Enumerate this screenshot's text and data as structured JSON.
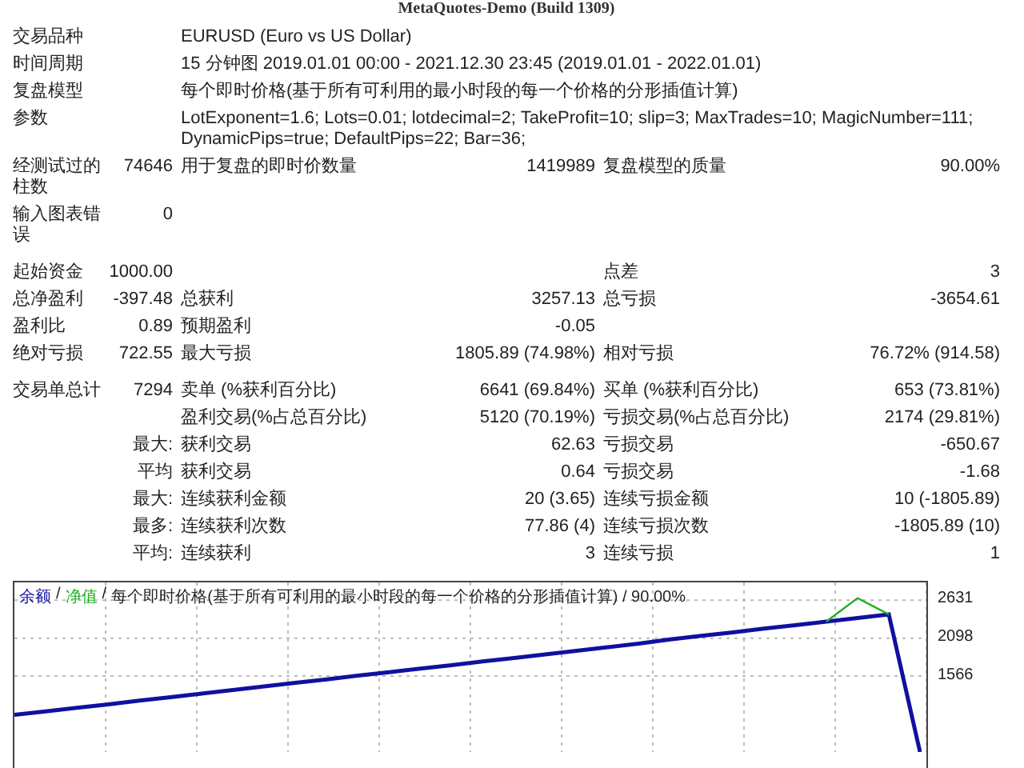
{
  "window": {
    "title": "MetaQuotes-Demo (Build 1309)"
  },
  "settings": [
    {
      "label": "交易品种",
      "text": "EURUSD (Euro vs US Dollar)"
    },
    {
      "label": "时间周期",
      "text": "15 分钟图 2019.01.01 00:00 - 2021.12.30 23:45 (2019.01.01 - 2022.01.01)"
    },
    {
      "label": "复盘模型",
      "text": "每个即时价格(基于所有可利用的最小时段的每一个价格的分形插值计算)"
    },
    {
      "label": "参数",
      "text": "LotExponent=1.6; Lots=0.01; lotdecimal=2; TakeProfit=10; slip=3; MaxTrades=10; MagicNumber=111; DynamicPips=true; DefaultPips=22; Bar=36;"
    }
  ],
  "test_info": [
    {
      "label": "经测试过的柱数",
      "value": "74646",
      "label_2": "用于复盘的即时价数量",
      "value_2": "1419989",
      "label_3": "复盘模型的质量",
      "value_3": "90.00%"
    },
    {
      "label": "输入图表错误",
      "value": "0"
    }
  ],
  "results": [
    {
      "label": "起始资金",
      "value": "1000.00",
      "label_3": "点差",
      "value_3": "3"
    },
    {
      "label": "总净盈利",
      "value": "-397.48",
      "label_2": "总获利",
      "value_2": "3257.13",
      "label_3": "总亏损",
      "value_3": "-3654.61"
    },
    {
      "label": "盈利比",
      "value": "0.89",
      "label_2": "预期盈利",
      "value_2": "-0.05"
    },
    {
      "label": "绝对亏损",
      "value": "722.55",
      "label_2": "最大亏损",
      "value_2": "1805.89 (74.98%)",
      "label_3": "相对亏损",
      "value_3": "76.72% (914.58)"
    }
  ],
  "trades": [
    {
      "label": "交易单总计",
      "value": "7294",
      "label_2": "卖单 (%获利百分比)",
      "value_2": "6641 (69.84%)",
      "label_3": "买单 (%获利百分比)",
      "value_3": "653 (73.81%)"
    },
    {
      "label_2": "盈利交易(%占总百分比)",
      "value_2": "5120 (70.19%)",
      "label_3": "亏损交易(%占总百分比)",
      "value_3": "2174 (29.81%)"
    },
    {
      "value": "最大:",
      "label_2": "获利交易",
      "value_2": "62.63",
      "label_3": "亏损交易",
      "value_3": "-650.67"
    },
    {
      "value": "平均",
      "label_2": "获利交易",
      "value_2": "0.64",
      "label_3": "亏损交易",
      "value_3": "-1.68"
    },
    {
      "value": "最大:",
      "label_2": "连续获利金额",
      "value_2": "20 (3.65)",
      "label_3": "连续亏损金额",
      "value_3": "10 (-1805.89)"
    },
    {
      "value": "最多:",
      "label_2": "连续获利次数",
      "value_2": "77.86 (4)",
      "label_3": "连续亏损次数",
      "value_3": "-1805.89 (10)"
    },
    {
      "value": "平均:",
      "label_2": "连续获利",
      "value_2": "3",
      "label_3": "连续亏损",
      "value_3": "1"
    }
  ],
  "chart": {
    "legend_separator": "/",
    "chart_data": {
      "type": "line",
      "grid": true,
      "title": "每个即时价格(基于所有可利用的最小时段的每一个价格的分形插值计算) / 90.00%",
      "ylim": [
        500,
        2880
      ],
      "yticks": [
        1566,
        2098,
        2631
      ],
      "series": [
        {
          "name": "余额",
          "color": "#1010a0",
          "values": [
            1020,
            1070,
            1120,
            1170,
            1220,
            1270,
            1320,
            1370,
            1420,
            1470,
            1520,
            1570,
            1620,
            1670,
            1720,
            1770,
            1820,
            1870,
            1920,
            1970,
            2020,
            2080,
            2130,
            2180,
            2230,
            2280,
            2330,
            2380,
            2430,
            500
          ]
        },
        {
          "name": "净值",
          "color": "#20b020",
          "values": [
            null,
            null,
            null,
            null,
            null,
            null,
            null,
            null,
            null,
            null,
            null,
            null,
            null,
            null,
            null,
            null,
            null,
            null,
            null,
            null,
            null,
            null,
            null,
            null,
            null,
            null,
            2330,
            2660,
            2430,
            null
          ]
        }
      ]
    }
  }
}
